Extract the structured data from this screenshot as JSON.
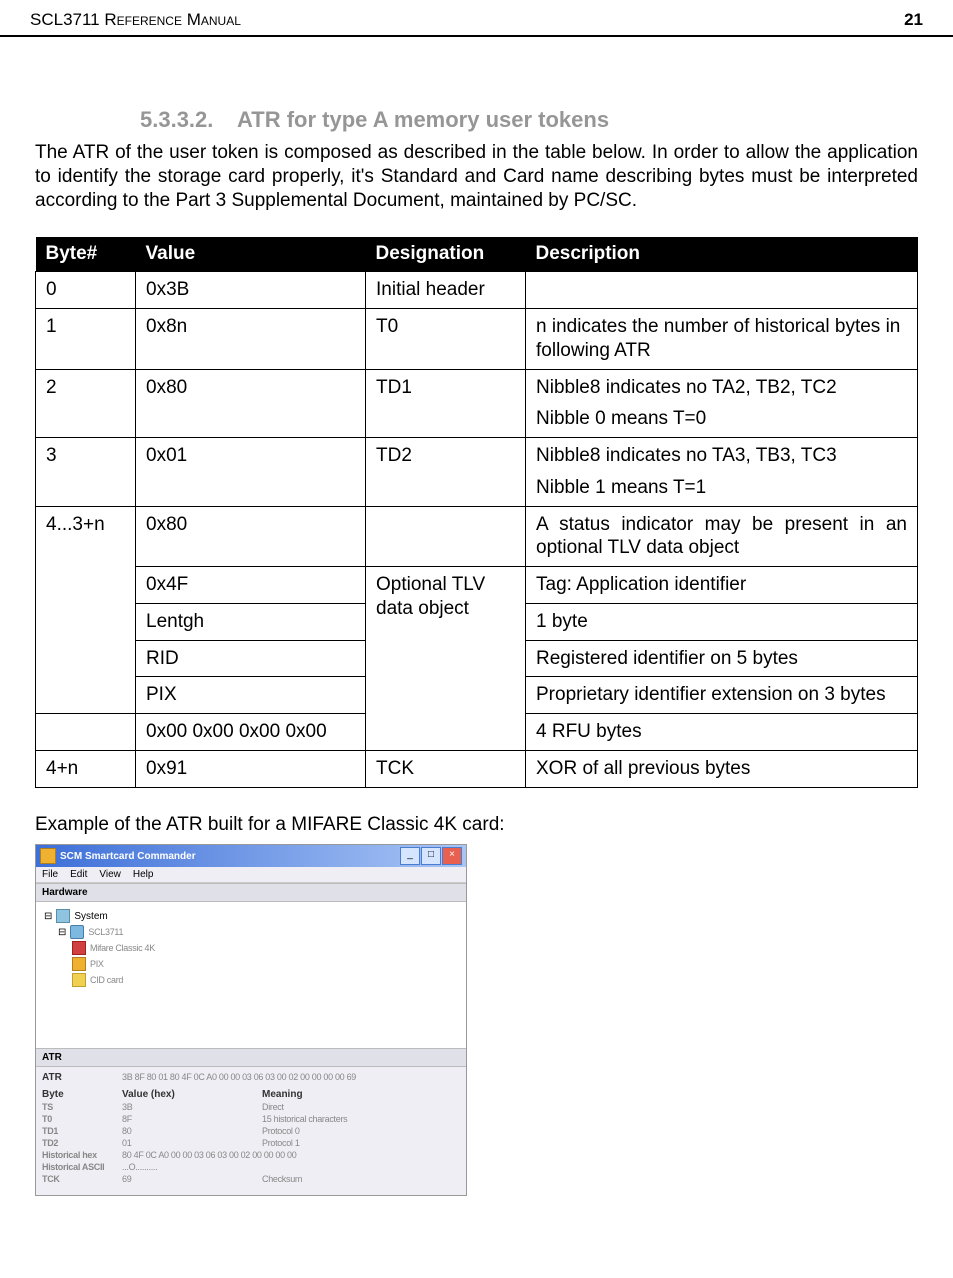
{
  "header": {
    "left": "SCL3711 Reference Manual",
    "right": "21"
  },
  "section": {
    "number": "5.3.3.2.",
    "title": "ATR for type A memory user tokens"
  },
  "intro": "The ATR of the user token is composed as described in the table below. In order to allow the application to identify the storage card properly, it's Standard and Card name describing bytes must be interpreted according to the Part 3 Supplemental Document, maintained by PC/SC.",
  "table": {
    "headers": [
      "Byte#",
      "Value",
      "Designation",
      "Description"
    ],
    "rows": {
      "r0": {
        "byte": "0",
        "value": "0x3B",
        "designation": "Initial header",
        "description": ""
      },
      "r1": {
        "byte": "1",
        "value": "0x8n",
        "designation": "T0",
        "description": "n indicates the number of historical bytes in following ATR"
      },
      "r2": {
        "byte": "2",
        "value": "0x80",
        "designation": "TD1",
        "desc1": "Nibble8 indicates no TA2, TB2, TC2",
        "desc2": "Nibble 0 means T=0"
      },
      "r3": {
        "byte": "3",
        "value": "0x01",
        "designation": "TD2",
        "desc1": "Nibble8 indicates no TA3, TB3, TC3",
        "desc2": "Nibble 1 means T=1"
      },
      "r4_byte": "4...3+n",
      "r4a": {
        "value": "0x80",
        "designation": "",
        "description": "A status indicator may be present in an optional TLV data object"
      },
      "r4_designation": "Optional TLV data object",
      "r4b": {
        "value": "0x4F",
        "description": "Tag: Application identifier"
      },
      "r4c": {
        "value": "Lentgh",
        "description": "1 byte"
      },
      "r4d": {
        "value": "RID",
        "description": "Registered identifier on 5 bytes"
      },
      "r4e": {
        "value": "PIX",
        "description": "Proprietary identifier extension on 3 bytes"
      },
      "r4f": {
        "value": "0x00 0x00 0x00 0x00",
        "description": "4 RFU bytes"
      },
      "r5": {
        "byte": "4+n",
        "value": "0x91",
        "designation": "TCK",
        "description": "XOR of all previous bytes"
      }
    }
  },
  "example_caption": "Example of the ATR built for a MIFARE Classic 4K card:",
  "screenshot": {
    "window_title": "SCM Smartcard Commander",
    "menu": {
      "file": "File",
      "edit": "Edit",
      "view": "View",
      "help": "Help"
    },
    "hardware_label": "Hardware",
    "tree": {
      "root": "System",
      "reader": "SCL3711",
      "mifare": "Mifare Classic 4K",
      "pix": "PIX",
      "cid": "CID card"
    },
    "atr_panel": {
      "label": "ATR",
      "atr_header": "ATR",
      "atr_value": "3B 8F 80 01 80 4F 0C A0 00 00 03 06 03 00 02 00 00 00 00 69",
      "cols": {
        "c1": "Byte",
        "c2": "Value (hex)",
        "c3": "Meaning"
      },
      "rows": {
        "r1": {
          "c1": "TS",
          "c2": "3B",
          "c3": "Direct"
        },
        "r2": {
          "c1": "T0",
          "c2": "8F",
          "c3": "15 historical characters"
        },
        "r3": {
          "c1": "TD1",
          "c2": "80",
          "c3": "Protocol 0"
        },
        "r4": {
          "c1": "TD2",
          "c2": "01",
          "c3": "Protocol 1"
        },
        "r5": {
          "c1": "Historical hex",
          "c2": "80 4F 0C A0 00 00 03 06 03 00 02 00 00 00 00",
          "c3": ""
        },
        "r6": {
          "c1": "Historical ASCII",
          "c2": "...O..........",
          "c3": ""
        },
        "r7": {
          "c1": "TCK",
          "c2": "69",
          "c3": "Checksum"
        }
      }
    }
  }
}
